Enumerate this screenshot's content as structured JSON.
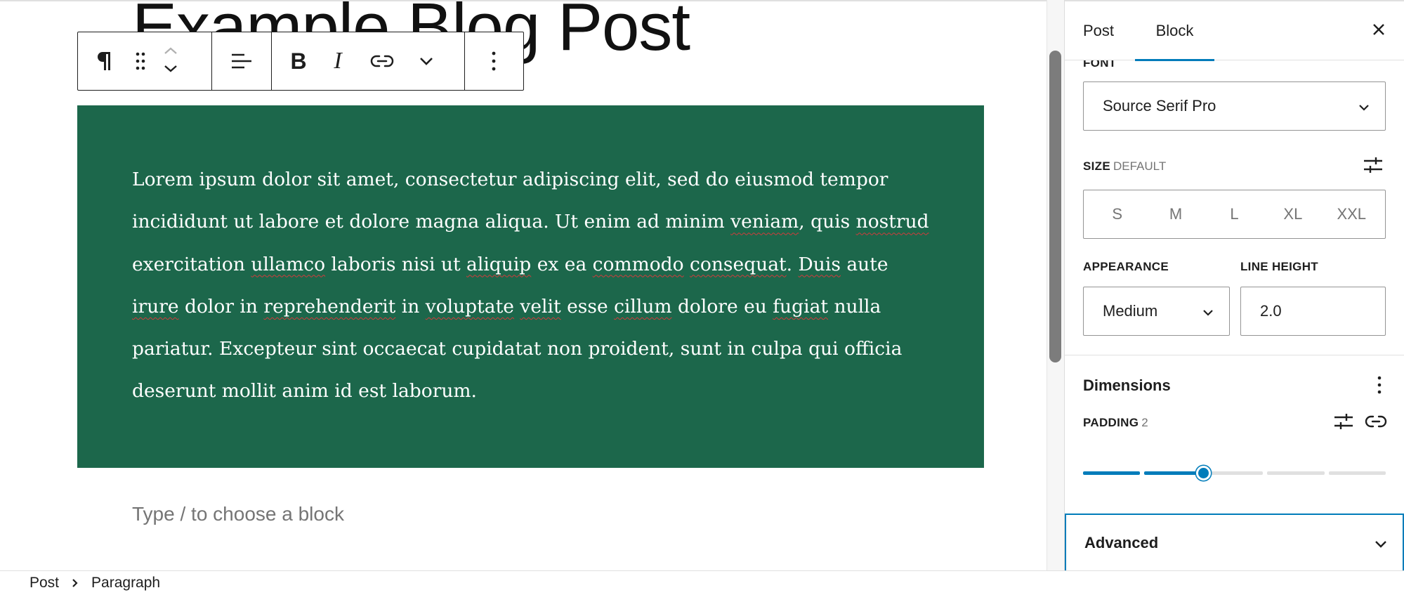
{
  "editor": {
    "post_title": "Example Blog Post",
    "paragraph_segments": [
      "Lorem ipsum dolor sit amet, consectetur adipiscing elit, sed do eiusmod tempor incididunt ut labore et dolore magna aliqua. Ut enim ad minim ",
      "veniam",
      ", quis ",
      "nostrud",
      " exercitation ",
      "ullamco",
      " laboris nisi ut ",
      "aliquip",
      " ex ea ",
      "commodo",
      " ",
      "consequat",
      ". ",
      "Duis",
      " aute ",
      "irure",
      " dolor in ",
      "reprehenderit",
      " in ",
      "voluptate",
      " ",
      "velit",
      " esse ",
      "cillum",
      " dolore eu ",
      "fugiat",
      " nulla pariatur. Excepteur sint occaecat cupidatat non proident, sunt in culpa qui officia deserunt mollit anim id est laborum."
    ],
    "paragraph_background": "#1c674b",
    "appender_placeholder": "Type / to choose a block"
  },
  "toolbar": {
    "icons": [
      "paragraph-icon",
      "drag-handle-icon",
      "move-up-icon",
      "move-down-icon",
      "align-left-icon",
      "bold-icon",
      "italic-icon",
      "link-icon",
      "more-formatting-chevron-icon",
      "options-kebab-icon"
    ],
    "bold_glyph": "B",
    "italic_glyph": "I"
  },
  "sidebar": {
    "tabs": [
      {
        "label": "Post",
        "active": false
      },
      {
        "label": "Block",
        "active": true
      }
    ],
    "accent_color": "#007cba",
    "typography": {
      "font_label": "FONT",
      "font_value": "Source Serif Pro",
      "size_label": "SIZE",
      "size_value": "DEFAULT",
      "size_options": [
        "S",
        "M",
        "L",
        "XL",
        "XXL"
      ],
      "appearance_label": "APPEARANCE",
      "appearance_value": "Medium",
      "line_height_label": "LINE HEIGHT",
      "line_height_value": "2.0"
    },
    "dimensions": {
      "title": "Dimensions",
      "padding_label": "PADDING",
      "padding_value": "2",
      "padding_slider_steps": 6,
      "padding_slider_position": 2
    },
    "advanced": {
      "title": "Advanced"
    }
  },
  "breadcrumb": {
    "items": [
      "Post",
      "Paragraph"
    ]
  }
}
